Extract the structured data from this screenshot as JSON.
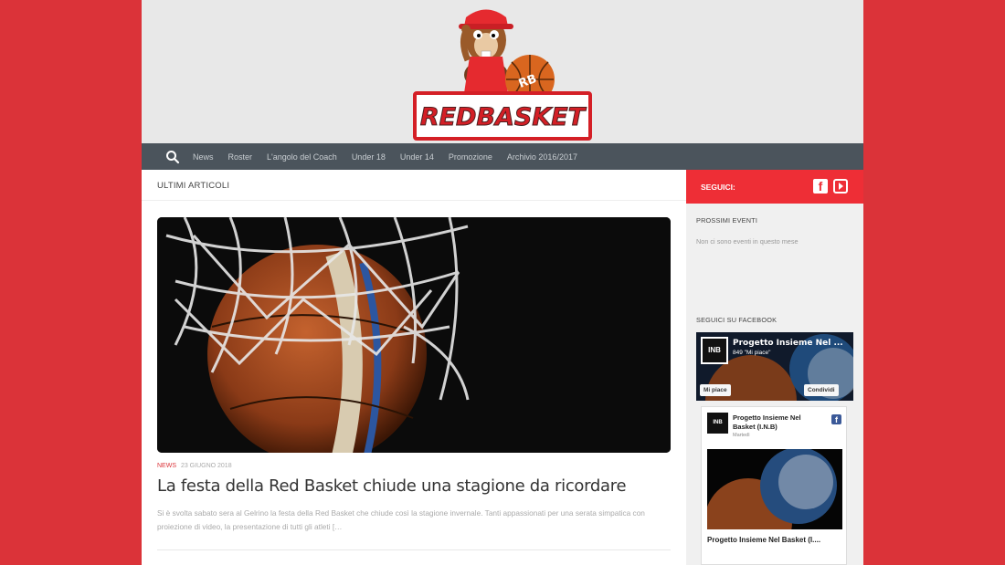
{
  "header": {
    "logo_text": "REDBASKET",
    "logo_ball_text": "RB"
  },
  "nav": {
    "items": [
      "News",
      "Roster",
      "L'angolo del Coach",
      "Under 18",
      "Under 14",
      "Promozione",
      "Archivio 2016/2017"
    ]
  },
  "main": {
    "section_title": "ULTIMI ARTICOLI",
    "article": {
      "category": "NEWS",
      "date": "23 GIUGNO 2018",
      "title": "La festa della Red Basket chiude una stagione da ricordare",
      "excerpt": "Si è svolta sabato sera al Gelrino  la festa della Red Basket che chiude così la stagione invernale. Tanti appassionati per una serata simpatica con proiezione di video, la presentazione di tutti gli atleti  […"
    }
  },
  "sidebar": {
    "follow_label": "SEGUICI:",
    "events_title": "PROSSIMI EVENTI",
    "events_empty": "Non ci sono eventi in questo mese",
    "facebook_title": "SEGUICI SU FACEBOOK",
    "fb_widget": {
      "page_name": "Progetto Insieme Nel ...",
      "likes": "849 \"Mi piace\"",
      "like_button": "Mi piace",
      "share_button": "Condividi",
      "logo_text": "INB"
    },
    "fb_post": {
      "page_name": "Progetto Insieme Nel Basket (I.N.B)",
      "day": "Martedì",
      "title": "Progetto Insieme Nel Basket (I...."
    }
  },
  "colors": {
    "page_background": "#db3339",
    "nav_background": "#4b545c",
    "accent_red": "#ee2e36"
  }
}
